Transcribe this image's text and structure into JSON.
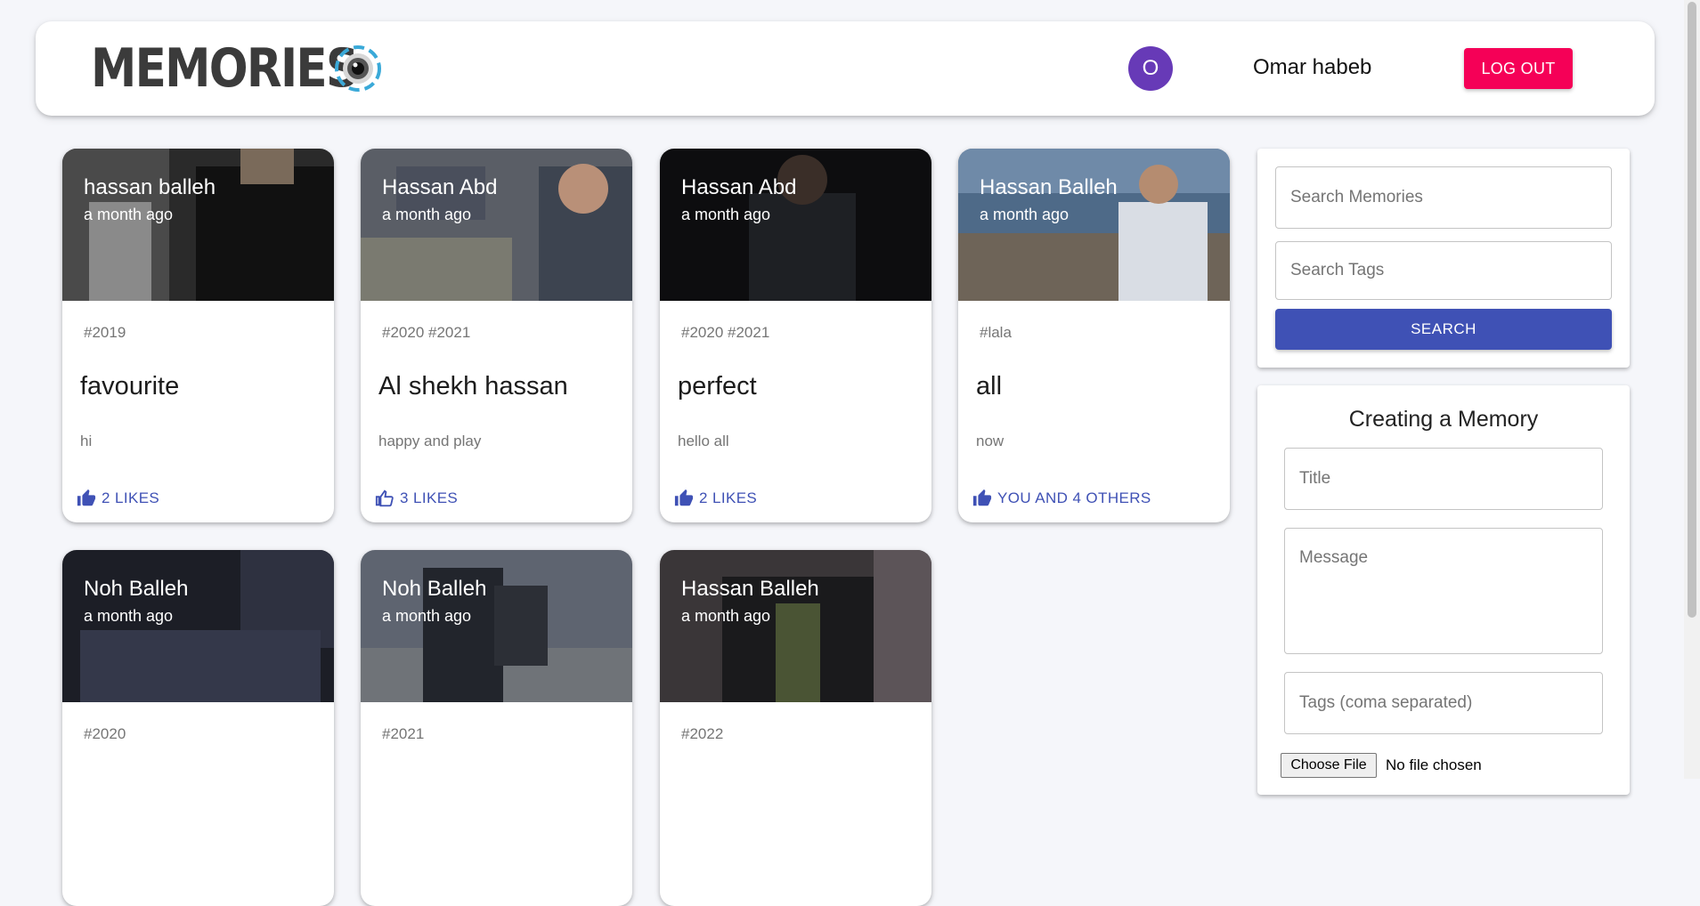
{
  "header": {
    "logo_text": "MEMORIES",
    "user_initial": "O",
    "user_name": "Omar habeb",
    "logout_label": "LOG OUT"
  },
  "posts": [
    {
      "author": "hassan balleh",
      "time": "a month ago",
      "tags": "#2019",
      "title": "favourite",
      "message": "hi",
      "likes": "2 LIKES"
    },
    {
      "author": "Hassan Abd",
      "time": "a month ago",
      "tags": "#2020 #2021",
      "title": "Al shekh hassan",
      "message": "happy and play",
      "likes": "3 LIKES"
    },
    {
      "author": "Hassan Abd",
      "time": "a month ago",
      "tags": "#2020 #2021",
      "title": "perfect",
      "message": "hello all",
      "likes": "2 LIKES"
    },
    {
      "author": "Hassan Balleh",
      "time": "a month ago",
      "tags": "#lala",
      "title": "all",
      "message": "now",
      "likes": "YOU AND 4 OTHERS"
    },
    {
      "author": "Noh Balleh",
      "time": "a month ago",
      "tags": "#2020"
    },
    {
      "author": "Noh Balleh",
      "time": "a month ago",
      "tags": "#2021"
    },
    {
      "author": "Hassan Balleh",
      "time": "a month ago",
      "tags": "#2022"
    }
  ],
  "search": {
    "memories_placeholder": "Search Memories",
    "tags_placeholder": "Search Tags",
    "button_label": "SEARCH"
  },
  "form": {
    "heading": "Creating a Memory",
    "title_placeholder": "Title",
    "message_placeholder": "Message",
    "tags_placeholder": "Tags (coma separated)",
    "file_button_label": "Choose File",
    "file_status": "No file chosen"
  },
  "colors": {
    "primary": "#3f51b5",
    "secondary": "#f50057",
    "avatar": "#673ab7",
    "background": "#f5f6fa"
  }
}
